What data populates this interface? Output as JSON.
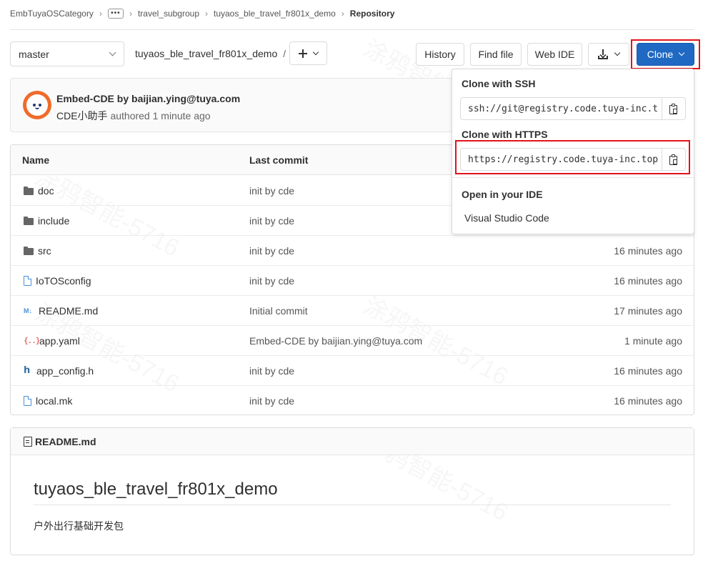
{
  "breadcrumb": {
    "items": [
      "EmbTuyaOSCategory",
      "•••",
      "travel_subgroup",
      "tuyaos_ble_travel_fr801x_demo",
      "Repository"
    ]
  },
  "toolbar": {
    "branch": "master",
    "project_path": "tuyaos_ble_travel_fr801x_demo",
    "path_separator": "/",
    "history_label": "History",
    "find_file_label": "Find file",
    "web_ide_label": "Web IDE",
    "clone_label": "Clone"
  },
  "commit": {
    "title": "Embed-CDE by baijian.ying@tuya.com",
    "author": "CDE小助手",
    "authored": "authored 1 minute ago"
  },
  "table": {
    "headers": {
      "name": "Name",
      "last_commit": "Last commit"
    },
    "rows": [
      {
        "icon": "folder-icon",
        "name": "doc",
        "commit": "init by cde",
        "time": ""
      },
      {
        "icon": "folder-icon",
        "name": "include",
        "commit": "init by cde",
        "time": ""
      },
      {
        "icon": "folder-icon",
        "name": "src",
        "commit": "init by cde",
        "time": "16 minutes ago"
      },
      {
        "icon": "file-icon",
        "name": "IoTOSconfig",
        "commit": "init by cde",
        "time": "16 minutes ago"
      },
      {
        "icon": "markdown-icon",
        "name": "README.md",
        "commit": "Initial commit",
        "time": "17 minutes ago"
      },
      {
        "icon": "yaml-icon",
        "name": "app.yaml",
        "commit": "Embed-CDE by baijian.ying@tuya.com",
        "time": "1 minute ago"
      },
      {
        "icon": "header-file-icon",
        "name": "app_config.h",
        "commit": "init by cde",
        "time": "16 minutes ago"
      },
      {
        "icon": "file-icon",
        "name": "local.mk",
        "commit": "init by cde",
        "time": "16 minutes ago"
      }
    ]
  },
  "readme": {
    "header": "README.md",
    "title": "tuyaos_ble_travel_fr801x_demo",
    "body": "户外出行基础开发包"
  },
  "clone_dropdown": {
    "ssh_label": "Clone with SSH",
    "ssh_url": "ssh://git@registry.code.tuya-inc.t",
    "https_label": "Clone with HTTPS",
    "https_url": "https://registry.code.tuya-inc.top",
    "ide_label": "Open in your IDE",
    "ide_option": "Visual Studio Code"
  },
  "icons": {
    "md": "M↓",
    "yaml": "{..}",
    "header": "h"
  },
  "colors": {
    "clone_button": "#1f69c3",
    "highlight": "#e1141b",
    "file_icon": "#4a90d9"
  }
}
